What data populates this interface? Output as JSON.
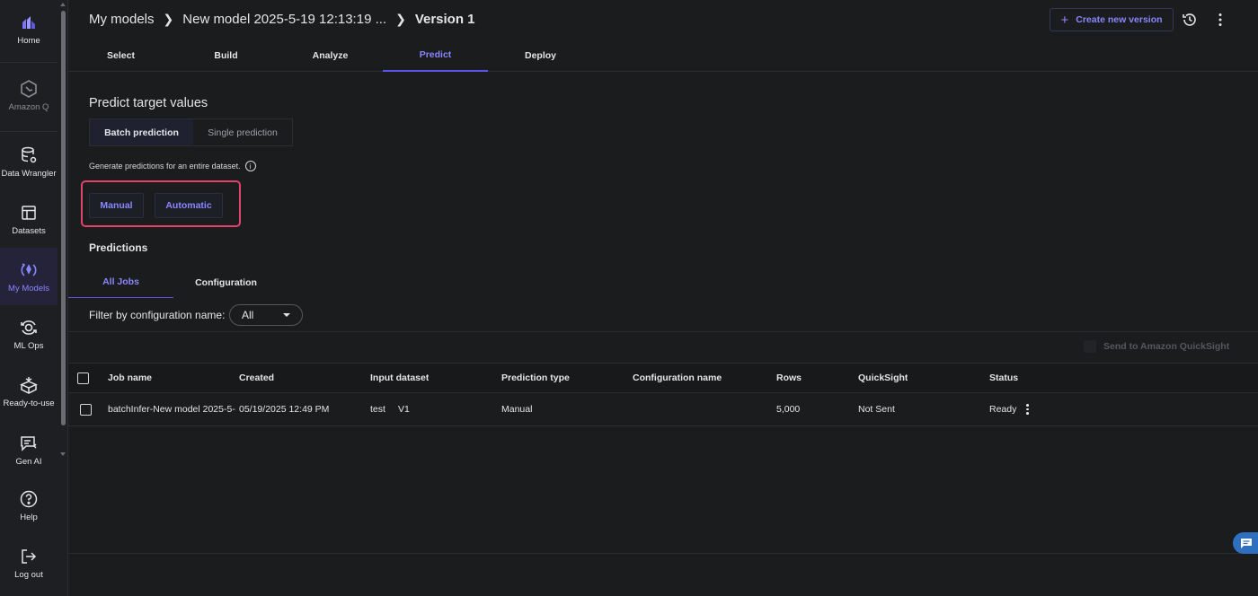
{
  "sidebar": {
    "items": [
      {
        "label": "Home"
      },
      {
        "label": "Amazon Q"
      },
      {
        "label": "Data Wrangler"
      },
      {
        "label": "Datasets"
      },
      {
        "label": "My Models"
      },
      {
        "label": "ML Ops"
      },
      {
        "label": "Ready-to-use"
      },
      {
        "label": "Gen AI"
      },
      {
        "label": "Help"
      },
      {
        "label": "Log out"
      }
    ]
  },
  "header": {
    "breadcrumb": [
      "My models",
      "New model 2025-5-19 12:13:19 ...",
      "Version 1"
    ],
    "create_version_label": "Create new version"
  },
  "main_tabs": [
    "Select",
    "Build",
    "Analyze",
    "Predict",
    "Deploy"
  ],
  "predict": {
    "title": "Predict target values",
    "segment": {
      "batch": "Batch prediction",
      "single": "Single prediction"
    },
    "help_text": "Generate predictions for an entire dataset.",
    "info_glyph": "i",
    "manual_label": "Manual",
    "automatic_label": "Automatic",
    "predictions_title": "Predictions",
    "sub_tabs": [
      "All Jobs",
      "Configuration"
    ],
    "filter_label": "Filter by configuration name:",
    "filter_value": "All",
    "quicksight_label": "Send to Amazon QuickSight"
  },
  "table": {
    "columns": [
      "Job name",
      "Created",
      "Input dataset",
      "Prediction type",
      "Configuration name",
      "Rows",
      "QuickSight",
      "Status"
    ],
    "rows": [
      {
        "job_name": "batchInfer-New model 2025-5-",
        "created": "05/19/2025 12:49 PM",
        "input_dataset": "test",
        "dataset_version": "V1",
        "prediction_type": "Manual",
        "configuration_name": "",
        "rows": "5,000",
        "quicksight": "Not Sent",
        "status": "Ready"
      }
    ]
  },
  "colors": {
    "accent": "#8a86ff",
    "highlight": "#e2416b",
    "chat": "#2f6fbf"
  }
}
